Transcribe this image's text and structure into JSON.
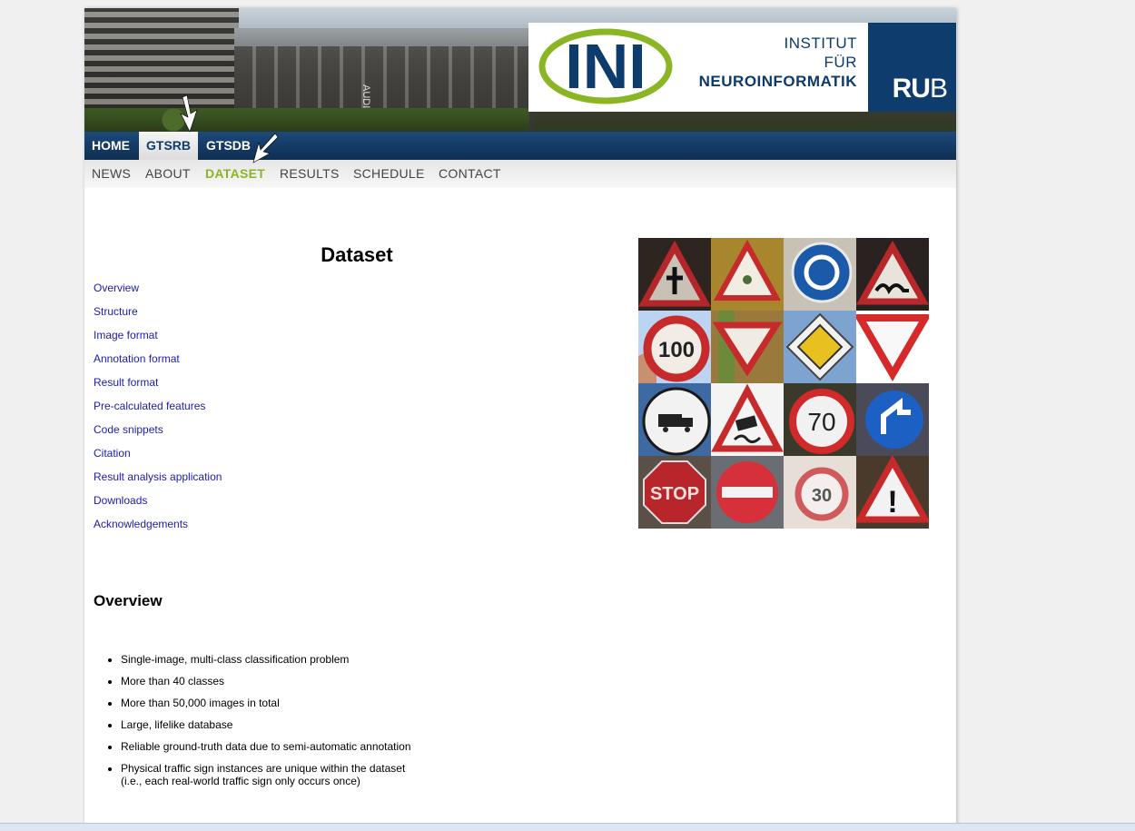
{
  "banner": {
    "ini_logo_text": "INI",
    "institute_line1": "INSTITUT",
    "institute_line2": "FÜR",
    "institute_line3": "NEUROINFORMATIK",
    "rub_bold": "RU",
    "rub_light": "B",
    "building_sign": "AUDIMAX"
  },
  "topnav": [
    "HOME",
    "GTSRB",
    "GTSDB"
  ],
  "subnav": [
    "NEWS",
    "ABOUT",
    "DATASET",
    "RESULTS",
    "SCHEDULE",
    "CONTACT"
  ],
  "title": "Dataset",
  "toc": [
    "Overview",
    "Structure",
    "Image format",
    "Annotation format",
    "Result format",
    "Pre-calculated features",
    "Code snippets",
    "Citation",
    "Result analysis application",
    "Downloads",
    "Acknowledgements"
  ],
  "sign_labels": {
    "speed100": "100",
    "speed70": "70",
    "speed30": "30",
    "stop": "STOP",
    "attention": "!"
  },
  "overview": {
    "heading": "Overview",
    "bullets": [
      "Single-image, multi-class classification problem",
      "More than 40 classes",
      "More than 50,000 images in total",
      "Large, lifelike database",
      "Reliable ground-truth data due to semi-automatic annotation",
      "Physical traffic sign instances are unique within the dataset",
      "(i.e., each real-world traffic sign only occurs once)"
    ]
  },
  "colors": {
    "brand_blue": "#0e3c6c",
    "ini_green": "#8ab624",
    "link": "#1b1bb0"
  }
}
